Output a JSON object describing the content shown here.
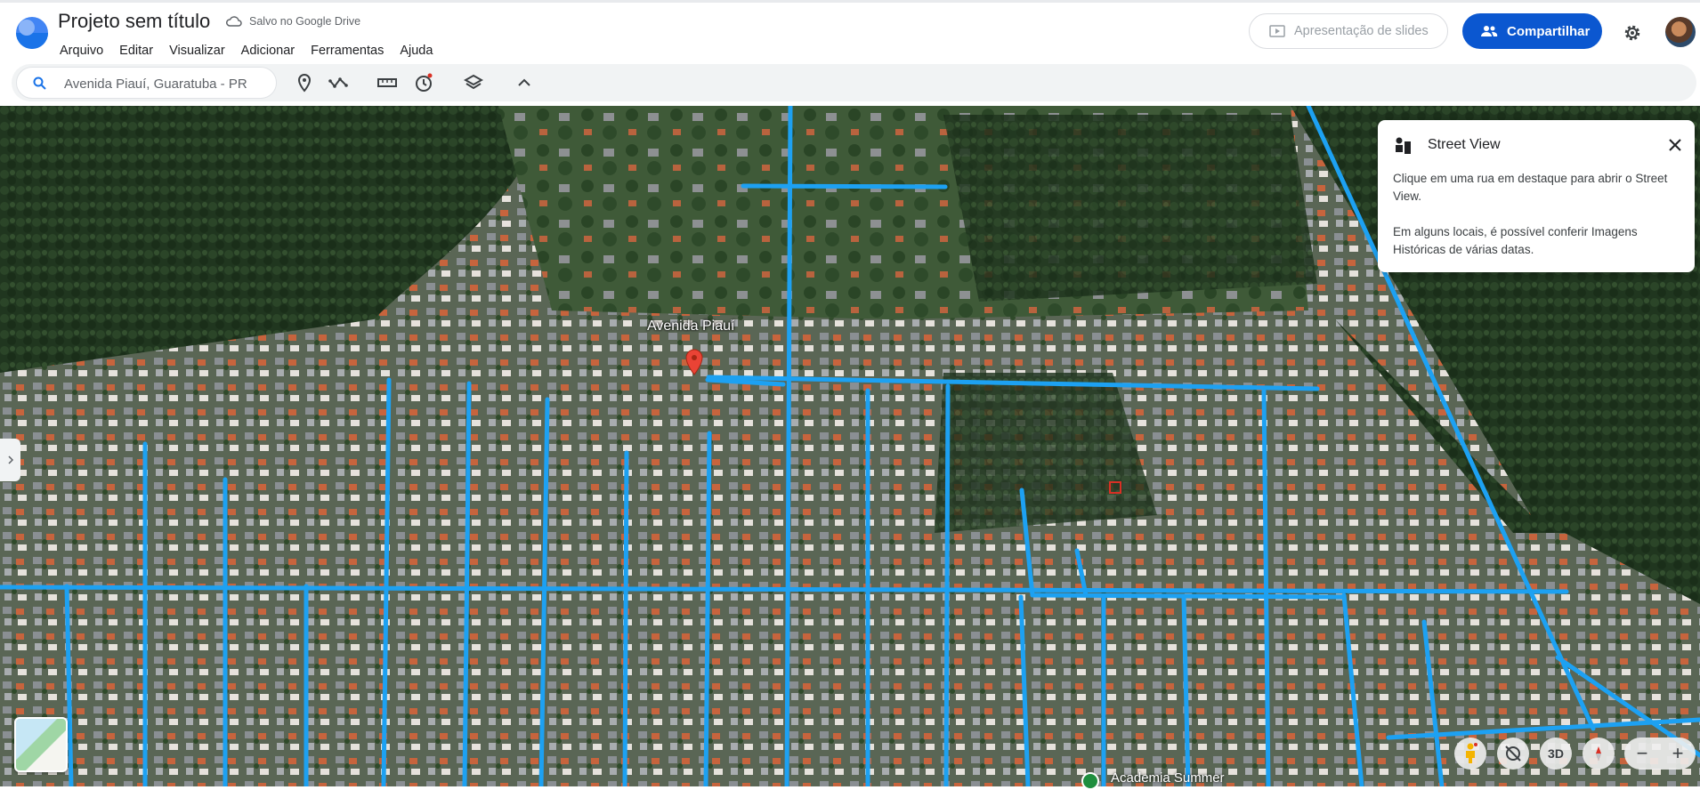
{
  "header": {
    "title": "Projeto sem título",
    "saved_status": "Salvo no Google Drive",
    "menu": [
      "Arquivo",
      "Editar",
      "Visualizar",
      "Adicionar",
      "Ferramentas",
      "Ajuda"
    ],
    "slides_button": "Apresentação de slides",
    "share_button": "Compartilhar"
  },
  "toolbar": {
    "search_value": "Avenida Piauí, Guaratuba - PR",
    "tools": [
      "pin-icon",
      "path-icon",
      "ruler-icon",
      "history-icon",
      "layers-icon",
      "collapse-icon"
    ]
  },
  "street_view_panel": {
    "title": "Street View",
    "line1": "Clique em uma rua em destaque para abrir o Street View.",
    "line2": "Em alguns locais, é possível conferir Imagens Históricas de várias datas."
  },
  "map": {
    "pin_label": "Avenida Piauí",
    "poi_label": "Academia Summer"
  },
  "controls": {
    "three_d": "3D",
    "zoom_out": "−",
    "zoom_in": "+"
  },
  "colors": {
    "accent": "#0b57d0",
    "street_highlight": "#1da1f2"
  }
}
